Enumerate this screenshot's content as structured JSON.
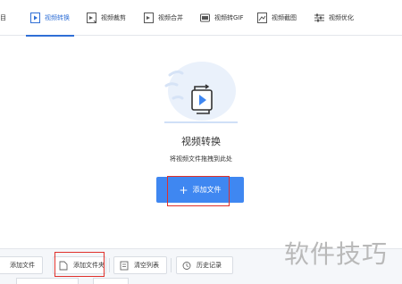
{
  "topbar": {
    "lead_label": "目",
    "tabs": [
      {
        "label": "视频转换",
        "icon": "video-convert-icon",
        "active": true
      },
      {
        "label": "视频裁剪",
        "icon": "video-trim-icon",
        "active": false
      },
      {
        "label": "视频合并",
        "icon": "video-merge-icon",
        "active": false
      },
      {
        "label": "视频转GIF",
        "icon": "video-to-gif-icon",
        "active": false
      },
      {
        "label": "视频截图",
        "icon": "video-screenshot-icon",
        "active": false
      },
      {
        "label": "视频优化",
        "icon": "video-optimize-icon",
        "active": false
      }
    ]
  },
  "main": {
    "hero_icon": "video-play-illustration-icon",
    "title": "视频转换",
    "hint": "将视频文件拖拽到此处",
    "add_button": {
      "label": "添加文件",
      "icon": "plus-icon"
    }
  },
  "bottombar": {
    "buttons": [
      {
        "label": "添加文件",
        "icon": "add-file-icon"
      },
      {
        "label": "添加文件夹",
        "icon": "add-folder-icon"
      },
      {
        "label": "清空列表",
        "icon": "clear-list-icon"
      },
      {
        "label": "历史记录",
        "icon": "history-icon"
      }
    ]
  },
  "watermark": "软件技巧",
  "colors": {
    "accent": "#3f87f1",
    "highlight": "#e0302b",
    "tab_active": "#2f6fd6"
  }
}
